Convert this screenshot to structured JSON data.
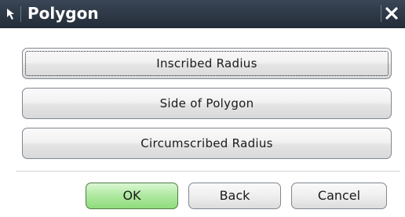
{
  "window": {
    "title": "Polygon",
    "icon": "select-arrow-icon",
    "close_icon": "close-icon"
  },
  "options": [
    {
      "label": "Inscribed Radius",
      "focused": true
    },
    {
      "label": "Side of Polygon",
      "focused": false
    },
    {
      "label": "Circumscribed Radius",
      "focused": false
    }
  ],
  "actions": {
    "ok_label": "OK",
    "back_label": "Back",
    "cancel_label": "Cancel"
  },
  "colors": {
    "titlebar": "#2b3441",
    "ok_button": "#a6e595"
  }
}
